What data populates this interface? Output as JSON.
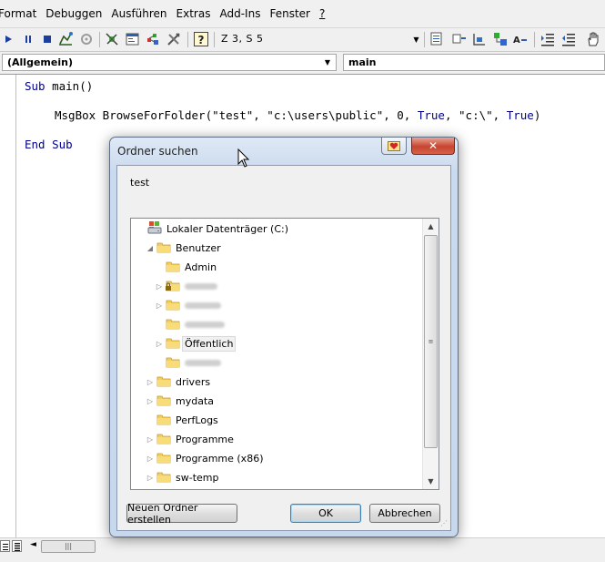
{
  "menu": [
    "Format",
    "Debuggen",
    "Ausführen",
    "Extras",
    "Add-Ins",
    "Fenster",
    "?"
  ],
  "toolbar": {
    "position_readout": "Z 3, S 5",
    "icons": [
      "run-icon",
      "pause-icon",
      "stop-icon",
      "design-mode-icon",
      "userform-icon",
      "project-explorer-icon",
      "properties-icon",
      "object-browser-icon",
      "toolbox-icon",
      "help-icon",
      "list-properties-icon",
      "list-constants-icon",
      "quick-info-icon",
      "parameter-info-icon",
      "complete-word-icon",
      "indent-icon",
      "outdent-icon",
      "hand-icon"
    ]
  },
  "combos": {
    "object": "(Allgemein)",
    "procedure": "main"
  },
  "code": {
    "line1": {
      "kw1": "Sub",
      "rest": " main()"
    },
    "line2": {
      "pre": "MsgBox BrowseForFolder(\"test\", \"c:\\users\\public\", 0, ",
      "kw_true1": "True",
      "mid": ", \"c:\\\", ",
      "kw_true2": "True",
      "post": ")"
    },
    "line3": {
      "kw": "End Sub"
    }
  },
  "dialog": {
    "title": "Ordner suchen",
    "close_label": "✕",
    "description": "test",
    "tree": [
      {
        "label": "Lokaler Datenträger (C:)",
        "icon": "drive-icon",
        "level": 0,
        "expander": ""
      },
      {
        "label": "Benutzer",
        "icon": "folder-icon",
        "level": 1,
        "expander": "expanded"
      },
      {
        "label": "Admin",
        "icon": "folder-icon",
        "level": 2,
        "expander": ""
      },
      {
        "label": "",
        "icon": "locked-folder-icon",
        "level": 2,
        "expander": "collapsed",
        "blurred": true
      },
      {
        "label": "",
        "icon": "folder-icon",
        "level": 2,
        "expander": "collapsed",
        "blurred": true
      },
      {
        "label": "",
        "icon": "folder-icon",
        "level": 2,
        "expander": "",
        "blurred": true
      },
      {
        "label": "Öffentlich",
        "icon": "folder-icon",
        "level": 2,
        "expander": "collapsed",
        "selected": true
      },
      {
        "label": "",
        "icon": "folder-icon",
        "level": 2,
        "expander": "",
        "blurred": true
      },
      {
        "label": "drivers",
        "icon": "folder-icon",
        "level": 1,
        "expander": "collapsed"
      },
      {
        "label": "mydata",
        "icon": "folder-icon",
        "level": 1,
        "expander": "collapsed"
      },
      {
        "label": "PerfLogs",
        "icon": "folder-icon",
        "level": 1,
        "expander": ""
      },
      {
        "label": "Programme",
        "icon": "folder-icon",
        "level": 1,
        "expander": "collapsed"
      },
      {
        "label": "Programme (x86)",
        "icon": "folder-icon",
        "level": 1,
        "expander": "collapsed"
      },
      {
        "label": "sw-temp",
        "icon": "folder-icon",
        "level": 1,
        "expander": "collapsed"
      }
    ],
    "buttons": {
      "new_folder": "Neuen Ordner erstellen",
      "ok": "OK",
      "cancel": "Abbrechen"
    }
  },
  "colors": {
    "keyword": "#00008b",
    "dialog_frame": "#c9d9ee",
    "close_button": "#c7452f"
  }
}
